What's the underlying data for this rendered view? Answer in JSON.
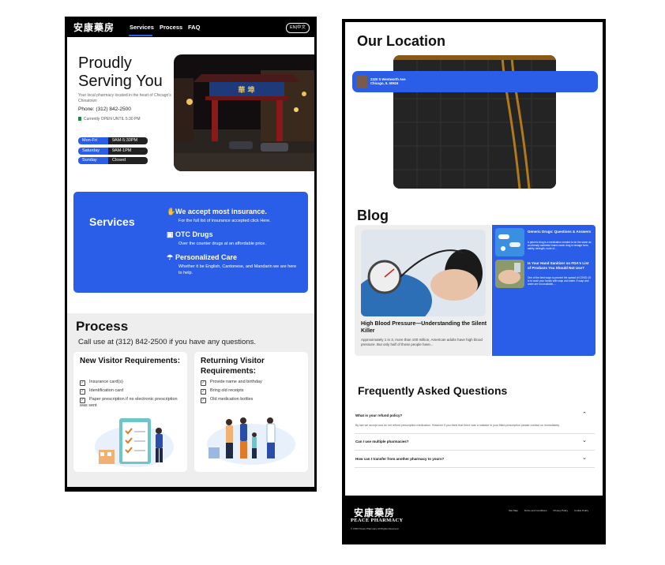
{
  "nav": {
    "logo_cn": "安康藥房",
    "links": [
      "Services",
      "Process",
      "FAQ"
    ],
    "lang": "EN|中文"
  },
  "hero": {
    "title": "Proudly Serving You",
    "subtitle": "Your local pharmacy located in the heart of Chicago's Chinatown",
    "phone": "Phone: (312) 842-2500",
    "status": "Currently OPEN UNTIL 5:30 PM",
    "hours": [
      {
        "day": "Mon-Fri",
        "time": "9AM-5:30PM"
      },
      {
        "day": "Saturday",
        "time": "9AM-1PM"
      },
      {
        "day": "Sunday",
        "time": "Closed"
      }
    ]
  },
  "services": {
    "title": "Services",
    "items": [
      {
        "icon": "hand-pill-icon",
        "title": "We accept most insurance.",
        "desc": "For the full list of insurance accepted click Here."
      },
      {
        "icon": "pill-bottle-icon",
        "title": "OTC Drugs",
        "desc": "Over the counter drugs at an affordable price."
      },
      {
        "icon": "umbrella-icon",
        "title": "Personalized Care",
        "desc": "Whether it be English, Cantonese, and Mandarin we are here to help."
      }
    ]
  },
  "process": {
    "title": "Process",
    "subtitle": "Call use at (312) 842-2500 if you have any questions.",
    "new_visitor": {
      "title": "New Visitor Requirements:",
      "items": [
        "Insurance card(s)",
        "Identification card",
        "Paper prescription if no electronic prescription was sent"
      ]
    },
    "returning_visitor": {
      "title": "Returning Visitor Requirements:",
      "items": [
        "Provide name and birthday",
        "Bring old receipts",
        "Old medication bottles"
      ]
    }
  },
  "location": {
    "title": "Our Location",
    "address_line1": "2320 S Wentworth Ave",
    "address_line2": "Chicago, IL 60616"
  },
  "blog": {
    "title": "Blog",
    "main": {
      "title": "High Blood Pressure—Understanding the Silent Killer",
      "excerpt": "Approximately 1 in 3, more than 100 million, American adults have high blood pressure. But only half of those people have..."
    },
    "side": [
      {
        "title": "Generic Drugs: Questions & Answers",
        "excerpt": "A generic drug is a medication created to be the same as an already marketed brand-name drug in dosage form, safety, strength, route of..."
      },
      {
        "title": "Is Your Hand Sanitizer on FDA's List of Products You Should Not Use?",
        "excerpt": "One of the best ways to prevent the spread of COVID-19 is to wash your hands with soap and water. If soap and water are not available,..."
      }
    ]
  },
  "faq": {
    "title": "Frequently Asked Questions",
    "items": [
      {
        "q": "What is your refund policy?",
        "a": "By law we accept and do not refund prescription medication. However if you think that there was a mistake in your filled prescription please contact us immediately.",
        "open": true
      },
      {
        "q": "Can I use multiple pharmacies?",
        "a": "",
        "open": false
      },
      {
        "q": "How can I transfer from another pharmacy to yours?",
        "a": "",
        "open": false
      }
    ]
  },
  "footer": {
    "logo_cn": "安康藥房",
    "logo_en": "PEACE PHARMACY",
    "copyright": "© 2022 Peace Pharmacy All Rights Reserved",
    "links": [
      "Site Map",
      "Terms and Conditions",
      "Privacy Policy",
      "Cookie Policy"
    ]
  },
  "colors": {
    "accent": "#2a5ee8",
    "dark": "#000000",
    "light_bg": "#eeeeee"
  }
}
